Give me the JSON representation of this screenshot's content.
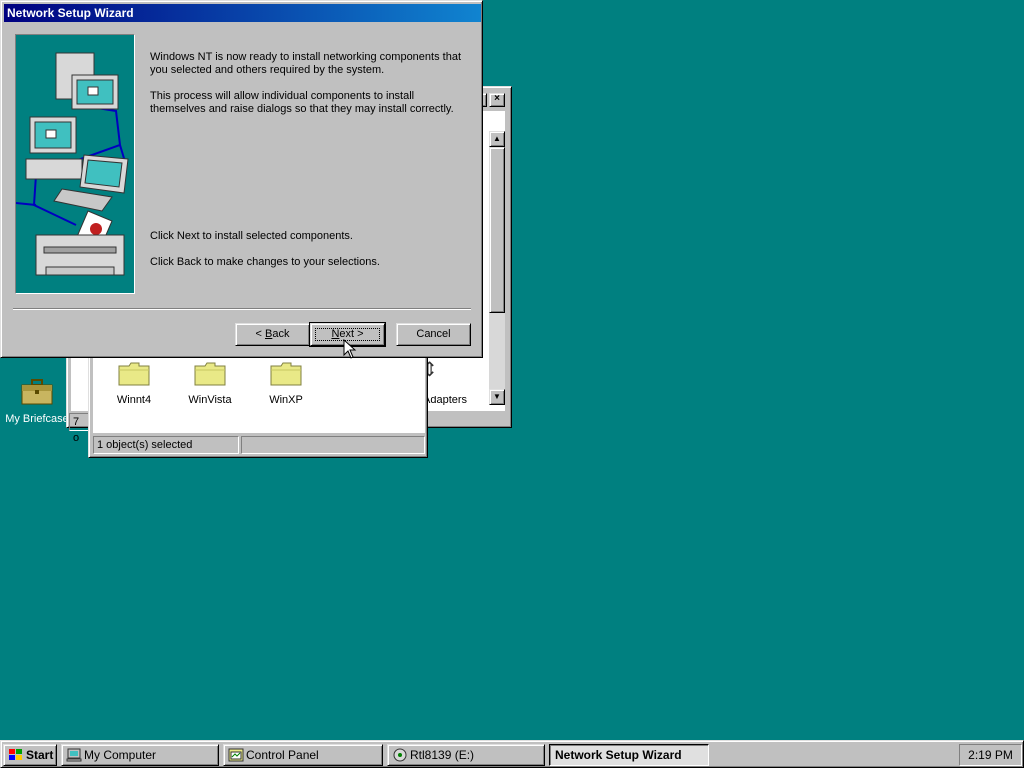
{
  "colors": {
    "desktop": "#008080",
    "title_active_start": "#000080",
    "title_active_end": "#1084d0",
    "face": "#c0c0c0",
    "folder": "#e9e987"
  },
  "desktop": {
    "icons": [
      {
        "label": "My Briefcase",
        "icon": "briefcase-icon"
      }
    ]
  },
  "control_panel_window": {
    "close_glyph": "×",
    "status_cell": "7 o",
    "adapter_label": "Adapters",
    "scroll_up": "▲",
    "scroll_down": "▼"
  },
  "explorer_window": {
    "folders": [
      {
        "label": "Winnt4",
        "icon": "folder-icon"
      },
      {
        "label": "WinVista",
        "icon": "folder-icon"
      },
      {
        "label": "WinXP",
        "icon": "folder-icon"
      }
    ],
    "status": "1 object(s) selected"
  },
  "wizard": {
    "title": "Network Setup Wizard",
    "paragraph1": "Windows NT is now ready to install networking components that you selected and others required by the system.",
    "paragraph2": "This process will allow individual components to install themselves and raise dialogs so that they may install correctly.",
    "paragraph3": "Click Next to install selected components.",
    "paragraph4": "Click Back to make changes to your selections.",
    "back_prefix": "< ",
    "back_key": "B",
    "back_rest": "ack",
    "next_key": "N",
    "next_rest": "ext >",
    "cancel_label": "Cancel"
  },
  "taskbar": {
    "start_label": "Start",
    "tasks": [
      {
        "label": "My Computer",
        "icon": "computer-icon"
      },
      {
        "label": "Control Panel",
        "icon": "control-panel-icon"
      },
      {
        "label": "Rtl8139 (E:)",
        "icon": "cd-drive-icon"
      },
      {
        "label": "Network Setup Wizard",
        "active": true
      }
    ],
    "clock": "2:19 PM"
  }
}
